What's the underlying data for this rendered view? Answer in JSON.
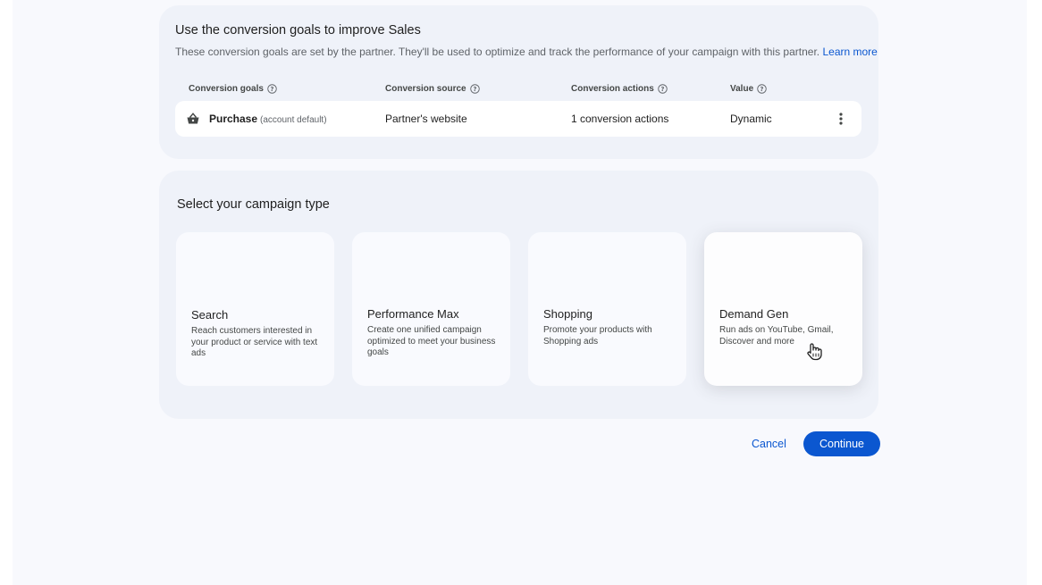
{
  "goals": {
    "title": "Use the conversion goals to improve Sales",
    "description": "These conversion goals are set by the partner. They'll be used to optimize and track the performance of your campaign with this partner.",
    "learn_more": "Learn more",
    "headers": {
      "goals": "Conversion goals",
      "source": "Conversion source",
      "actions": "Conversion actions",
      "value": "Value"
    },
    "row": {
      "icon": "shopping-basket-icon",
      "name": "Purchase",
      "note": "(account default)",
      "source": "Partner's website",
      "actions": "1 conversion actions",
      "value": "Dynamic"
    }
  },
  "campaign_type": {
    "title": "Select your campaign type",
    "tiles": [
      {
        "name": "Search",
        "description": "Reach customers interested in your product or service with text ads"
      },
      {
        "name": "Performance Max",
        "description": "Create one unified campaign optimized to meet your business goals"
      },
      {
        "name": "Shopping",
        "description": "Promote your products with Shopping ads"
      },
      {
        "name": "Demand Gen",
        "description": "Run ads on YouTube, Gmail, Discover and more"
      }
    ]
  },
  "actions": {
    "cancel": "Cancel",
    "continue": "Continue"
  },
  "colors": {
    "accent": "#0b57d0",
    "card_bg": "#eff2f9",
    "page_bg": "#f8f9fd"
  }
}
